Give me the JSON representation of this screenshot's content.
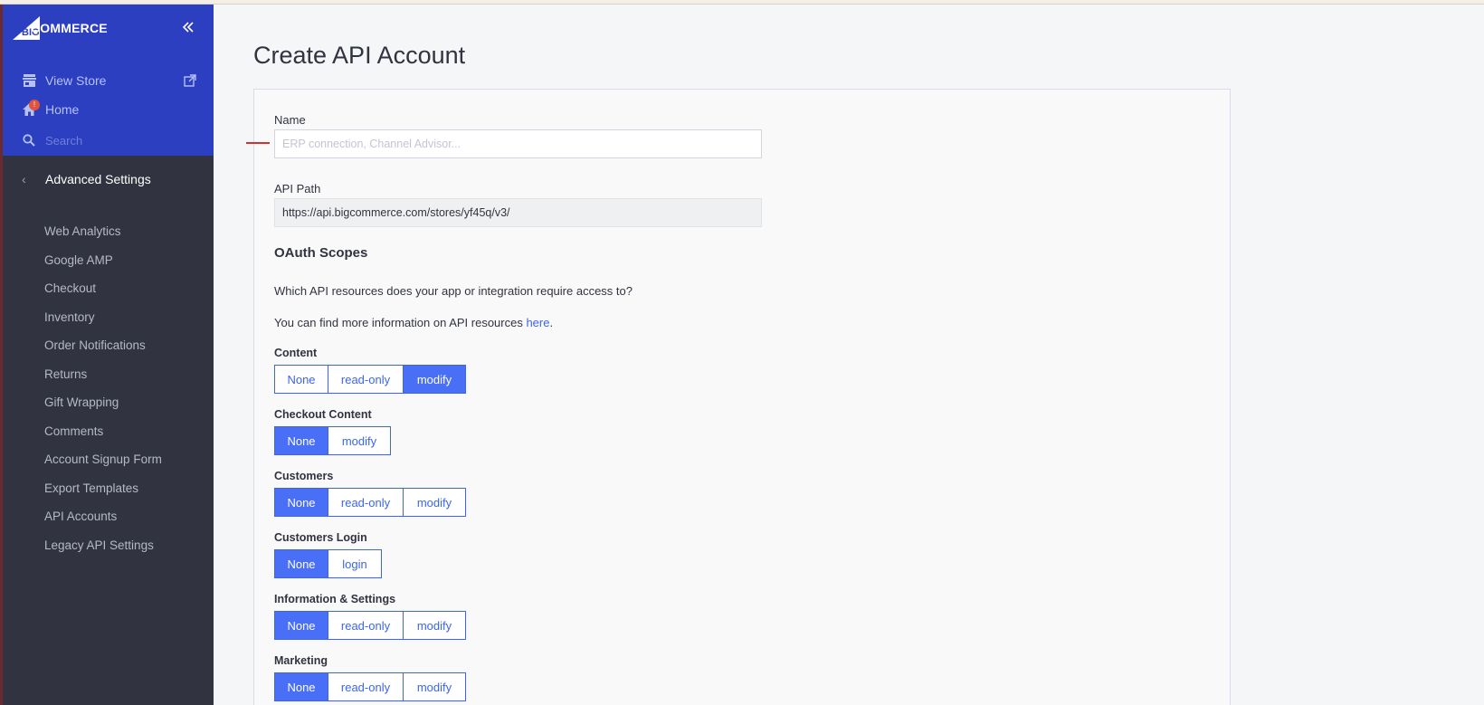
{
  "brand": {
    "logo_text": "COMMERCE",
    "logo_prefix": "BIG"
  },
  "sidebar": {
    "view_store": "View Store",
    "home": "Home",
    "home_badge": "!",
    "search_placeholder": "Search",
    "section_title": "Advanced Settings",
    "items": [
      "Web Analytics",
      "Google AMP",
      "Checkout",
      "Inventory",
      "Order Notifications",
      "Returns",
      "Gift Wrapping",
      "Comments",
      "Account Signup Form",
      "Export Templates",
      "API Accounts",
      "Legacy API Settings"
    ]
  },
  "page": {
    "title": "Create API Account",
    "name_label": "Name",
    "name_placeholder": "ERP connection, Channel Advisor...",
    "name_value": "",
    "api_path_label": "API Path",
    "api_path_value": "https://api.bigcommerce.com/stores/yf45q/v3/",
    "oauth_heading": "OAuth Scopes",
    "question": "Which API resources does your app or integration require access to?",
    "info_prefix": "You can find more information on API resources ",
    "info_link": "here",
    "info_suffix": "."
  },
  "scopes": [
    {
      "label": "Content",
      "options": [
        "None",
        "read-only",
        "modify"
      ],
      "selected": "modify"
    },
    {
      "label": "Checkout Content",
      "options": [
        "None",
        "modify"
      ],
      "selected": "None"
    },
    {
      "label": "Customers",
      "options": [
        "None",
        "read-only",
        "modify"
      ],
      "selected": "None"
    },
    {
      "label": "Customers Login",
      "options": [
        "None",
        "login"
      ],
      "selected": "None"
    },
    {
      "label": "Information & Settings",
      "options": [
        "None",
        "read-only",
        "modify"
      ],
      "selected": "None"
    },
    {
      "label": "Marketing",
      "options": [
        "None",
        "read-only",
        "modify"
      ],
      "selected": "None"
    }
  ],
  "colors": {
    "sidebar_top": "#2c3fc0",
    "sidebar_bottom": "#313440",
    "accent": "#3c64f4",
    "badge": "#e0543e"
  }
}
